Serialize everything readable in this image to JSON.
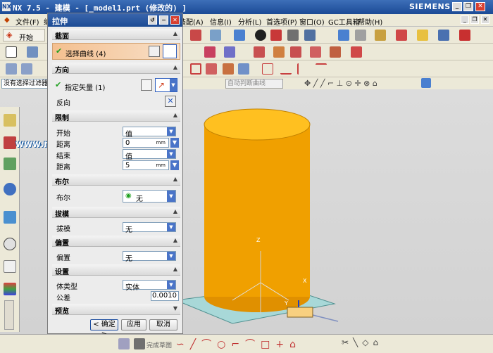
{
  "window": {
    "title": "NX 7.5 - 建模 - [_model1.prt  (修改的) ]",
    "brand": "SIEMENS",
    "logo": "NX"
  },
  "menubar": [
    "文件(F)",
    "编",
    "装配(A)",
    "信息(I)",
    "分析(L)",
    "首选项(P)",
    "窗口(O)",
    "GC工具箱",
    "帮助(H)"
  ],
  "toolbar": {
    "start": "开始",
    "filter": "没有选择过滤器",
    "assembly": "自动判断曲线"
  },
  "dialog": {
    "title": "拉伸",
    "sections": {
      "section": "截面",
      "direction": "方向",
      "limits": "限制",
      "boolean": "布尔",
      "draft": "拔模",
      "offset": "偏置",
      "settings": "设置",
      "preview": "预览"
    },
    "select_curve": "选择曲线 (4)",
    "specify_vector": "指定矢量 (1)",
    "reverse": "反向",
    "start_label": "开始",
    "start_value": "值",
    "start_dist_label": "距离",
    "start_dist": "0",
    "unit": "mm",
    "end_label": "结束",
    "end_value": "值",
    "end_dist_label": "距离",
    "end_dist": "5",
    "boolean_label": "布尔",
    "boolean_value": "无",
    "draft_label": "拔模",
    "draft_value": "无",
    "offset_label": "偏置",
    "offset_value": "无",
    "body_type_label": "体类型",
    "body_type_value": "实体",
    "tolerance_label": "公差",
    "tolerance_value": "0.0010",
    "ok": "< 确定 >",
    "apply": "应用",
    "cancel": "取消"
  },
  "watermark": "www.rjzxw.com",
  "axis": {
    "z": "Z",
    "x": "X",
    "y": "Y"
  },
  "bottombar": {
    "finish_sketch": "完成草图"
  },
  "colors": {
    "cylinder": "#f0a000",
    "plane": "#a8d8d8",
    "title": "#1c4b94"
  }
}
